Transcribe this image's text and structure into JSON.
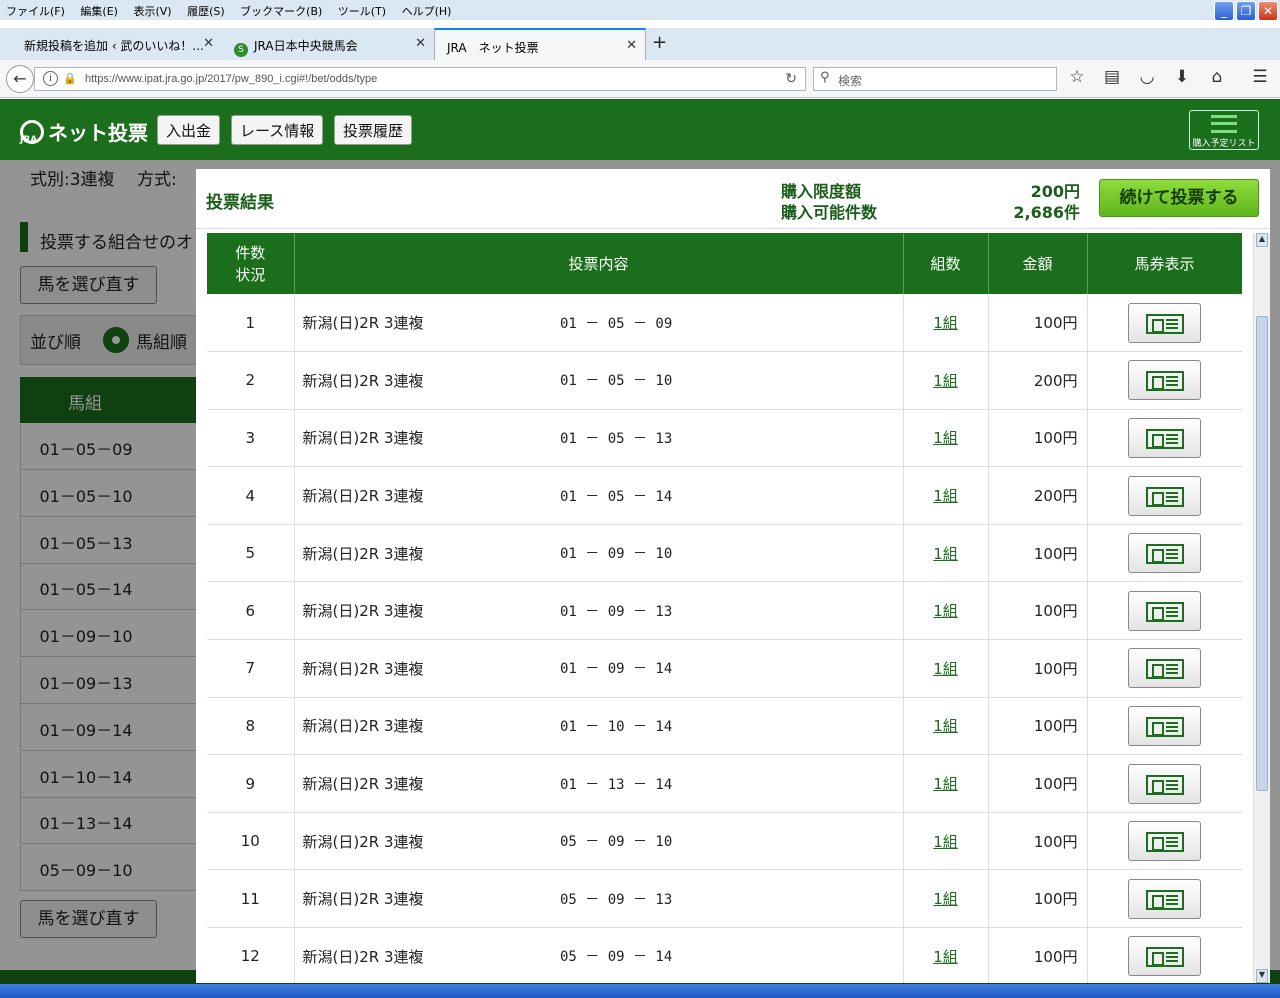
{
  "browser": {
    "menus": [
      "ファイル(F)",
      "編集(E)",
      "表示(V)",
      "履歴(S)",
      "ブックマーク(B)",
      "ツール(T)",
      "ヘルプ(H)"
    ],
    "tabs": [
      {
        "label": "新規投稿を追加 ‹ 武のいいね！..."
      },
      {
        "label": "JRA日本中央競馬会"
      },
      {
        "label": "JRA　ネット投票"
      }
    ],
    "url": "https://www.ipat.jra.go.jp/2017/pw_890_i.cgi#!/bet/odds/type",
    "search_placeholder": "検索"
  },
  "header": {
    "logo_text": "ネット投票",
    "logo_sub": "JRA",
    "buttons": [
      "入出金",
      "レース情報",
      "投票履歴"
    ],
    "cart_label": "購入予定リスト"
  },
  "background_page": {
    "type_line": "式別:3連複　 方式:",
    "section_title": "投票する組合せのオ",
    "reselect_label": "馬を選び直す",
    "sort_label": "並び順",
    "sort_option": "馬組順",
    "col_header": "馬組",
    "combos": [
      "01－05－09",
      "01－05－10",
      "01－05－13",
      "01－05－14",
      "01－09－10",
      "01－09－13",
      "01－09－14",
      "01－10－14",
      "01－13－14",
      "05－09－10"
    ]
  },
  "modal": {
    "title": "投票結果",
    "limit_label": "購入限度額",
    "limit_value": "200円",
    "count_label": "購入可能件数",
    "count_value": "2,686件",
    "continue_label": "続けて投票する",
    "headers": {
      "status": "件数\n状況",
      "content": "投票内容",
      "kumi": "組数",
      "amount": "金額",
      "ticket": "馬券表示"
    },
    "rows": [
      {
        "no": "1",
        "race": "新潟(日)2R 3連複",
        "combo": "01 － 05 － 09",
        "kumi": "1組",
        "amount": "100円"
      },
      {
        "no": "2",
        "race": "新潟(日)2R 3連複",
        "combo": "01 － 05 － 10",
        "kumi": "1組",
        "amount": "200円"
      },
      {
        "no": "3",
        "race": "新潟(日)2R 3連複",
        "combo": "01 － 05 － 13",
        "kumi": "1組",
        "amount": "100円"
      },
      {
        "no": "4",
        "race": "新潟(日)2R 3連複",
        "combo": "01 － 05 － 14",
        "kumi": "1組",
        "amount": "200円"
      },
      {
        "no": "5",
        "race": "新潟(日)2R 3連複",
        "combo": "01 － 09 － 10",
        "kumi": "1組",
        "amount": "100円"
      },
      {
        "no": "6",
        "race": "新潟(日)2R 3連複",
        "combo": "01 － 09 － 13",
        "kumi": "1組",
        "amount": "100円"
      },
      {
        "no": "7",
        "race": "新潟(日)2R 3連複",
        "combo": "01 － 09 － 14",
        "kumi": "1組",
        "amount": "100円"
      },
      {
        "no": "8",
        "race": "新潟(日)2R 3連複",
        "combo": "01 － 10 － 14",
        "kumi": "1組",
        "amount": "100円"
      },
      {
        "no": "9",
        "race": "新潟(日)2R 3連複",
        "combo": "01 － 13 － 14",
        "kumi": "1組",
        "amount": "100円"
      },
      {
        "no": "10",
        "race": "新潟(日)2R 3連複",
        "combo": "05 － 09 － 10",
        "kumi": "1組",
        "amount": "100円"
      },
      {
        "no": "11",
        "race": "新潟(日)2R 3連複",
        "combo": "05 － 09 － 13",
        "kumi": "1組",
        "amount": "100円"
      },
      {
        "no": "12",
        "race": "新潟(日)2R 3連複",
        "combo": "05 － 09 － 14",
        "kumi": "1組",
        "amount": "100円"
      }
    ]
  },
  "colors": {
    "brand_green": "#1b6e1b",
    "accent_green": "#6cc126"
  }
}
